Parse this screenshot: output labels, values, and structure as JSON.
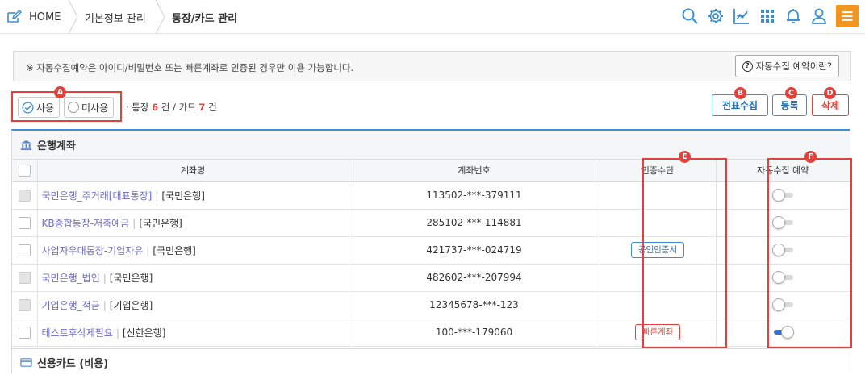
{
  "breadcrumb": {
    "home": "HOME",
    "level1": "기본정보 관리",
    "level2": "통장/카드 관리"
  },
  "toolbar_icons": [
    "search-icon",
    "gear-icon",
    "chart-icon",
    "apps-grid-icon",
    "bell-icon",
    "user-icon",
    "menu-icon"
  ],
  "notice": {
    "text": "※ 자동수집예약은 아이디/비밀번호 또는 빠른계좌로 인증된 경우만 이용 가능합니다.",
    "help_button": "자동수집 예약이란?"
  },
  "filter": {
    "use_label": "사용",
    "unused_label": "미사용",
    "selected": "사용"
  },
  "counts": {
    "prefix": "· 통장 ",
    "bank_count": "6",
    "mid": " 건 / 카드 ",
    "card_count": "7",
    "suffix": " 건"
  },
  "actions": {
    "collect": "전표수집",
    "register": "등록",
    "delete": "삭제"
  },
  "markers": {
    "a": "A",
    "b": "B",
    "c": "C",
    "d": "D",
    "e": "E",
    "f": "F"
  },
  "bank_section": {
    "title": "은행계좌",
    "columns": [
      "계좌명",
      "계좌번호",
      "인증수단",
      "자동수집 예약"
    ],
    "rows": [
      {
        "name": "국민은행_주거래[대표통장]",
        "bank": "[국민은행]",
        "number": "113502-***-379111",
        "auth": "",
        "auto": false,
        "disabled": true
      },
      {
        "name": "KB종합통장-저축예금",
        "bank": "[국민은행]",
        "number": "285102-***-114881",
        "auth": "",
        "auto": false,
        "disabled": false
      },
      {
        "name": "사업자우대통장-기업자유",
        "bank": "[국민은행]",
        "number": "421737-***-024719",
        "auth": "공인인증서",
        "auto": false,
        "disabled": false
      },
      {
        "name": "국민은행_법인",
        "bank": "[국민은행]",
        "number": "482602-***-207994",
        "auth": "",
        "auto": false,
        "disabled": true
      },
      {
        "name": "기업은행_적금",
        "bank": "[기업은행]",
        "number": "12345678-***-123",
        "auth": "",
        "auto": false,
        "disabled": true
      },
      {
        "name": "테스트후삭제필요",
        "bank": "[신한은행]",
        "number": "100-***-179060",
        "auth": "빠른계좌",
        "auto": true,
        "disabled": false
      }
    ]
  },
  "card_section": {
    "title": "신용카드 (비용)"
  },
  "colors": {
    "accent": "#3a8fd6",
    "highlight": "#e2423b",
    "menu": "#f3961f",
    "link": "#6b6bce"
  }
}
